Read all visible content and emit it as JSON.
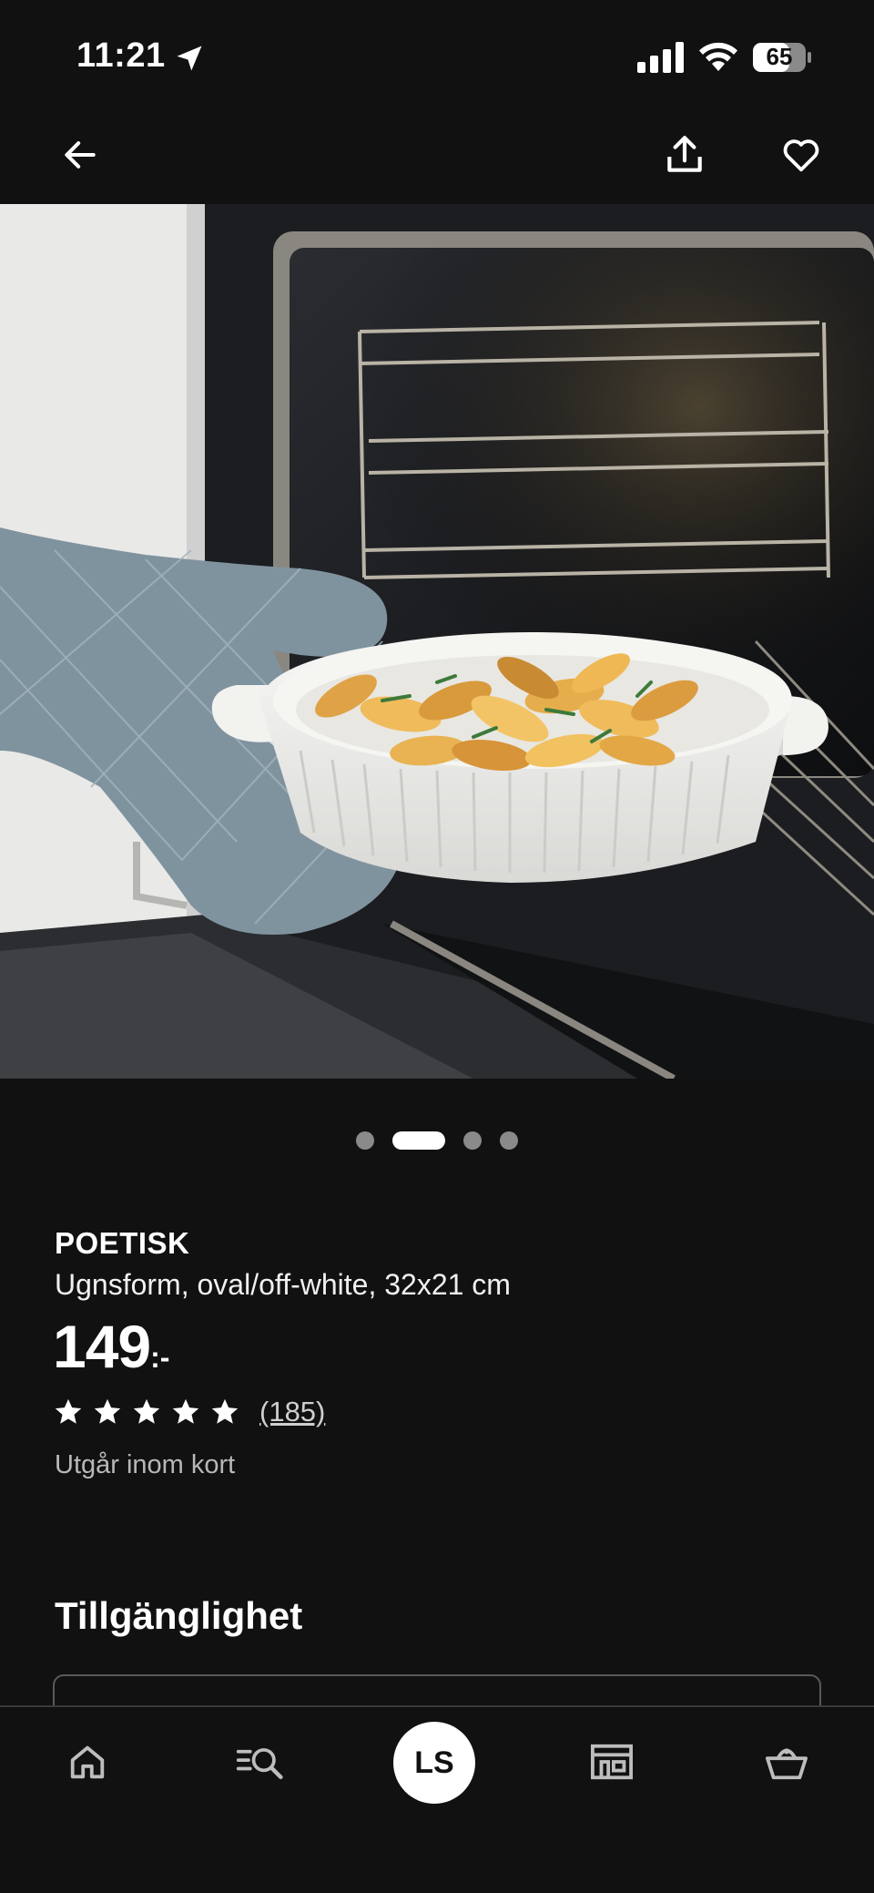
{
  "status_bar": {
    "time": "11:21",
    "battery": "65"
  },
  "header": {
    "back_icon": "arrow-left-icon",
    "share_icon": "share-icon",
    "favorite_icon": "heart-icon"
  },
  "carousel": {
    "count": 4,
    "active_index": 1
  },
  "product": {
    "name": "POETISK",
    "description": "Ugnsform, oval/off-white, 32x21 cm",
    "price": "149",
    "price_suffix": ":-",
    "rating": 5,
    "review_count": "(185)",
    "availability_note": "Utgår inom kort"
  },
  "availability": {
    "title": "Tillgänglighet"
  },
  "bottom_nav": {
    "profile_initials": "LS",
    "items": [
      "home-icon",
      "search-list-icon",
      "profile-avatar",
      "store-icon",
      "basket-icon"
    ]
  },
  "colors": {
    "background": "#111112",
    "text": "#ffffff",
    "muted": "#b8b8b8"
  }
}
